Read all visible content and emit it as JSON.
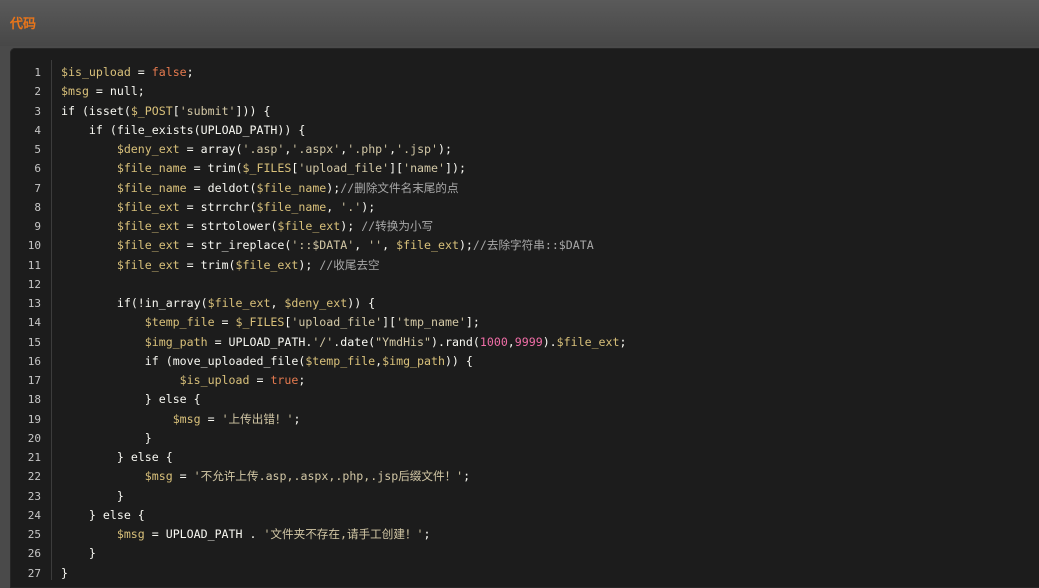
{
  "header": {
    "title": "代码"
  },
  "code": {
    "lines": [
      {
        "n": "1",
        "tokens": [
          [
            "var",
            "$is_upload"
          ],
          [
            "pl",
            " = "
          ],
          [
            "bool",
            "false"
          ],
          [
            "pl",
            ";"
          ]
        ]
      },
      {
        "n": "2",
        "tokens": [
          [
            "var",
            "$msg"
          ],
          [
            "pl",
            " = "
          ],
          [
            "kw",
            "null"
          ],
          [
            "pl",
            ";"
          ]
        ]
      },
      {
        "n": "3",
        "tokens": [
          [
            "kw",
            "if"
          ],
          [
            "pl",
            " (isset("
          ],
          [
            "var",
            "$_POST"
          ],
          [
            "pl",
            "["
          ],
          [
            "str",
            "'submit'"
          ],
          [
            "pl",
            "])) {"
          ]
        ]
      },
      {
        "n": "4",
        "tokens": [
          [
            "pl",
            "    "
          ],
          [
            "kw",
            "if"
          ],
          [
            "pl",
            " ("
          ],
          [
            "fn",
            "file_exists"
          ],
          [
            "pl",
            "("
          ],
          [
            "const",
            "UPLOAD_PATH"
          ],
          [
            "pl",
            ")) {"
          ]
        ]
      },
      {
        "n": "5",
        "tokens": [
          [
            "pl",
            "        "
          ],
          [
            "var",
            "$deny_ext"
          ],
          [
            "pl",
            " = "
          ],
          [
            "fn",
            "array"
          ],
          [
            "pl",
            "("
          ],
          [
            "str",
            "'.asp'"
          ],
          [
            "pl",
            ","
          ],
          [
            "str",
            "'.aspx'"
          ],
          [
            "pl",
            ","
          ],
          [
            "str",
            "'.php'"
          ],
          [
            "pl",
            ","
          ],
          [
            "str",
            "'.jsp'"
          ],
          [
            "pl",
            ");"
          ]
        ]
      },
      {
        "n": "6",
        "tokens": [
          [
            "pl",
            "        "
          ],
          [
            "var",
            "$file_name"
          ],
          [
            "pl",
            " = "
          ],
          [
            "fn",
            "trim"
          ],
          [
            "pl",
            "("
          ],
          [
            "var",
            "$_FILES"
          ],
          [
            "pl",
            "["
          ],
          [
            "str",
            "'upload_file'"
          ],
          [
            "pl",
            "]["
          ],
          [
            "str",
            "'name'"
          ],
          [
            "pl",
            "]);"
          ]
        ]
      },
      {
        "n": "7",
        "tokens": [
          [
            "pl",
            "        "
          ],
          [
            "var",
            "$file_name"
          ],
          [
            "pl",
            " = "
          ],
          [
            "fn",
            "deldot"
          ],
          [
            "pl",
            "("
          ],
          [
            "var",
            "$file_name"
          ],
          [
            "pl",
            ");"
          ],
          [
            "com",
            "//删除文件名末尾的点"
          ]
        ]
      },
      {
        "n": "8",
        "tokens": [
          [
            "pl",
            "        "
          ],
          [
            "var",
            "$file_ext"
          ],
          [
            "pl",
            " = "
          ],
          [
            "fn",
            "strrchr"
          ],
          [
            "pl",
            "("
          ],
          [
            "var",
            "$file_name"
          ],
          [
            "pl",
            ", "
          ],
          [
            "str",
            "'.'"
          ],
          [
            "pl",
            ");"
          ]
        ]
      },
      {
        "n": "9",
        "tokens": [
          [
            "pl",
            "        "
          ],
          [
            "var",
            "$file_ext"
          ],
          [
            "pl",
            " = "
          ],
          [
            "fn",
            "strtolower"
          ],
          [
            "pl",
            "("
          ],
          [
            "var",
            "$file_ext"
          ],
          [
            "pl",
            "); "
          ],
          [
            "com",
            "//转换为小写"
          ]
        ]
      },
      {
        "n": "10",
        "tokens": [
          [
            "pl",
            "        "
          ],
          [
            "var",
            "$file_ext"
          ],
          [
            "pl",
            " = "
          ],
          [
            "fn",
            "str_ireplace"
          ],
          [
            "pl",
            "("
          ],
          [
            "str",
            "'::$DATA'"
          ],
          [
            "pl",
            ", "
          ],
          [
            "str",
            "''"
          ],
          [
            "pl",
            ", "
          ],
          [
            "var",
            "$file_ext"
          ],
          [
            "pl",
            ");"
          ],
          [
            "com",
            "//去除字符串::$DATA"
          ]
        ]
      },
      {
        "n": "11",
        "tokens": [
          [
            "pl",
            "        "
          ],
          [
            "var",
            "$file_ext"
          ],
          [
            "pl",
            " = "
          ],
          [
            "fn",
            "trim"
          ],
          [
            "pl",
            "("
          ],
          [
            "var",
            "$file_ext"
          ],
          [
            "pl",
            "); "
          ],
          [
            "com",
            "//收尾去空"
          ]
        ]
      },
      {
        "n": "12",
        "tokens": []
      },
      {
        "n": "13",
        "tokens": [
          [
            "pl",
            "        "
          ],
          [
            "kw",
            "if"
          ],
          [
            "pl",
            "(!"
          ],
          [
            "fn",
            "in_array"
          ],
          [
            "pl",
            "("
          ],
          [
            "var",
            "$file_ext"
          ],
          [
            "pl",
            ", "
          ],
          [
            "var",
            "$deny_ext"
          ],
          [
            "pl",
            ")) {"
          ]
        ]
      },
      {
        "n": "14",
        "tokens": [
          [
            "pl",
            "            "
          ],
          [
            "var",
            "$temp_file"
          ],
          [
            "pl",
            " = "
          ],
          [
            "var",
            "$_FILES"
          ],
          [
            "pl",
            "["
          ],
          [
            "str",
            "'upload_file'"
          ],
          [
            "pl",
            "]["
          ],
          [
            "str",
            "'tmp_name'"
          ],
          [
            "pl",
            "];"
          ]
        ]
      },
      {
        "n": "15",
        "tokens": [
          [
            "pl",
            "            "
          ],
          [
            "var",
            "$img_path"
          ],
          [
            "pl",
            " = "
          ],
          [
            "const",
            "UPLOAD_PATH"
          ],
          [
            "pl",
            "."
          ],
          [
            "str",
            "'/'"
          ],
          [
            "pl",
            "."
          ],
          [
            "fn",
            "date"
          ],
          [
            "pl",
            "("
          ],
          [
            "str",
            "\"YmdHis\""
          ],
          [
            "pl",
            ")."
          ],
          [
            "fn",
            "rand"
          ],
          [
            "pl",
            "("
          ],
          [
            "num",
            "1000"
          ],
          [
            "pl",
            ","
          ],
          [
            "num",
            "9999"
          ],
          [
            "pl",
            ")."
          ],
          [
            "var",
            "$file_ext"
          ],
          [
            "pl",
            ";"
          ]
        ]
      },
      {
        "n": "16",
        "tokens": [
          [
            "pl",
            "            "
          ],
          [
            "kw",
            "if"
          ],
          [
            "pl",
            " ("
          ],
          [
            "fn",
            "move_uploaded_file"
          ],
          [
            "pl",
            "("
          ],
          [
            "var",
            "$temp_file"
          ],
          [
            "pl",
            ","
          ],
          [
            "var",
            "$img_path"
          ],
          [
            "pl",
            ")) {"
          ]
        ]
      },
      {
        "n": "17",
        "tokens": [
          [
            "pl",
            "                 "
          ],
          [
            "var",
            "$is_upload"
          ],
          [
            "pl",
            " = "
          ],
          [
            "bool",
            "true"
          ],
          [
            "pl",
            ";"
          ]
        ]
      },
      {
        "n": "18",
        "tokens": [
          [
            "pl",
            "            } "
          ],
          [
            "kw",
            "else"
          ],
          [
            "pl",
            " {"
          ]
        ]
      },
      {
        "n": "19",
        "tokens": [
          [
            "pl",
            "                "
          ],
          [
            "var",
            "$msg"
          ],
          [
            "pl",
            " = "
          ],
          [
            "str",
            "'上传出错！'"
          ],
          [
            "pl",
            ";"
          ]
        ]
      },
      {
        "n": "20",
        "tokens": [
          [
            "pl",
            "            }"
          ]
        ]
      },
      {
        "n": "21",
        "tokens": [
          [
            "pl",
            "        } "
          ],
          [
            "kw",
            "else"
          ],
          [
            "pl",
            " {"
          ]
        ]
      },
      {
        "n": "22",
        "tokens": [
          [
            "pl",
            "            "
          ],
          [
            "var",
            "$msg"
          ],
          [
            "pl",
            " = "
          ],
          [
            "str",
            "'不允许上传.asp,.aspx,.php,.jsp后缀文件！'"
          ],
          [
            "pl",
            ";"
          ]
        ]
      },
      {
        "n": "23",
        "tokens": [
          [
            "pl",
            "        }"
          ]
        ]
      },
      {
        "n": "24",
        "tokens": [
          [
            "pl",
            "    } "
          ],
          [
            "kw",
            "else"
          ],
          [
            "pl",
            " {"
          ]
        ]
      },
      {
        "n": "25",
        "tokens": [
          [
            "pl",
            "        "
          ],
          [
            "var",
            "$msg"
          ],
          [
            "pl",
            " = "
          ],
          [
            "const",
            "UPLOAD_PATH"
          ],
          [
            "pl",
            " . "
          ],
          [
            "str",
            "'文件夹不存在,请手工创建！'"
          ],
          [
            "pl",
            ";"
          ]
        ]
      },
      {
        "n": "26",
        "tokens": [
          [
            "pl",
            "    }"
          ]
        ]
      },
      {
        "n": "27",
        "tokens": [
          [
            "pl",
            "}"
          ]
        ]
      }
    ]
  }
}
